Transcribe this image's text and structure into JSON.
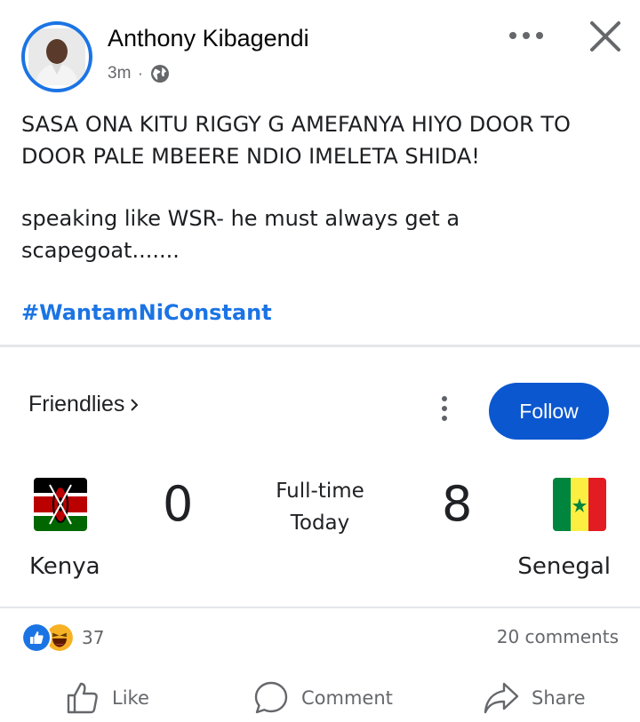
{
  "post": {
    "author": "Anthony Kibagendi",
    "time": "3m",
    "separator": "·",
    "audience_icon": "globe-icon",
    "text_line_1": "SASA ONA KITU RIGGY G AMEFANYA HIYO DOOR TO DOOR PALE MBEERE NDIO IMELETA SHIDA!",
    "text_line_2": "speaking like WSR- he must always get a scapegoat.......",
    "hashtag": "#WantamNiConstant"
  },
  "match": {
    "competition": "Friendlies",
    "follow_label": "Follow",
    "status": "Full-time",
    "date": "Today",
    "home_team": "Kenya",
    "home_score": "0",
    "away_team": "Senegal",
    "away_score": "8",
    "colors": {
      "follow_bg": "#0b57d0"
    }
  },
  "engagement": {
    "reaction_count": "37",
    "reaction_icons": [
      "like-icon",
      "haha-icon"
    ],
    "comments": "20 comments"
  },
  "actions": {
    "like": "Like",
    "comment": "Comment",
    "share": "Share"
  },
  "colors": {
    "accent": "#1b74e4",
    "secondary_text": "#65676b"
  }
}
